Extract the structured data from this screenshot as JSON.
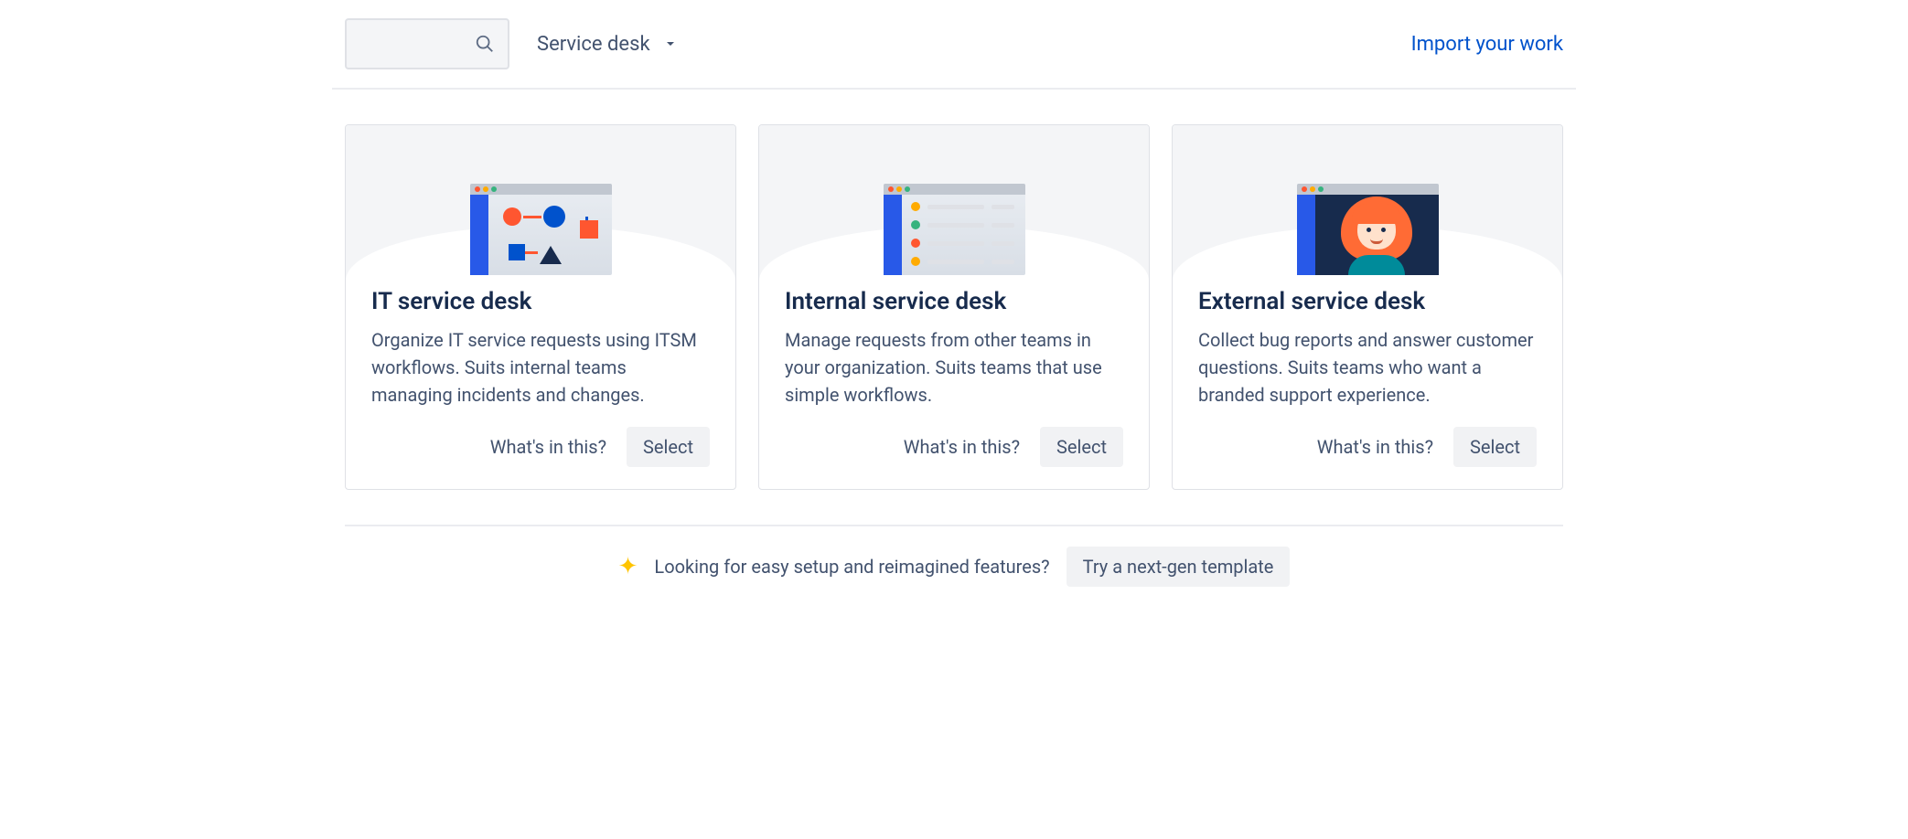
{
  "topbar": {
    "filter_label": "Service desk",
    "import_link": "Import your work"
  },
  "templates": [
    {
      "title": "IT service desk",
      "description": "Organize IT service requests using ITSM workflows. Suits internal teams managing incidents and changes.",
      "info_link": "What's in this?",
      "select_label": "Select"
    },
    {
      "title": "Internal service desk",
      "description": "Manage requests from other teams in your organization. Suits teams that use simple workflows.",
      "info_link": "What's in this?",
      "select_label": "Select"
    },
    {
      "title": "External service desk",
      "description": "Collect bug reports and answer customer questions. Suits teams who want a branded support experience.",
      "info_link": "What's in this?",
      "select_label": "Select"
    }
  ],
  "footer": {
    "prompt_text": "Looking for easy setup and reimagined features?",
    "cta_label": "Try a next-gen template"
  }
}
